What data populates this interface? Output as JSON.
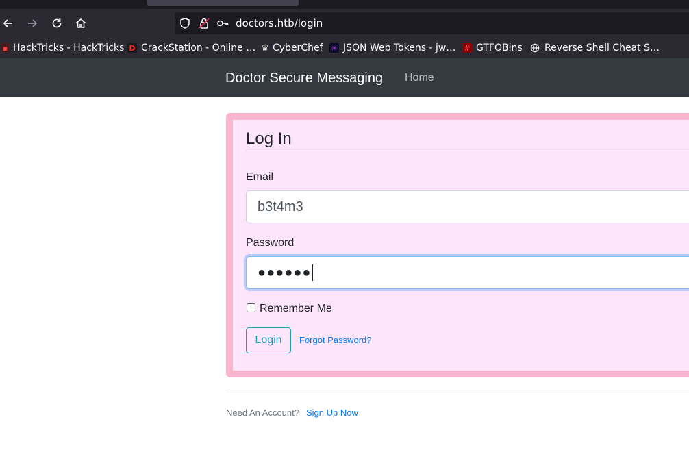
{
  "browser": {
    "url": "doctors.htb/login",
    "bookmarks": [
      {
        "label": "HackTricks - HackTricks",
        "icon": "hacktricks-icon"
      },
      {
        "label": "CrackStation - Online …",
        "icon": "crackstation-icon"
      },
      {
        "label": "CyberChef",
        "icon": "cyberchef-icon"
      },
      {
        "label": "JSON Web Tokens - jw…",
        "icon": "jwt-icon"
      },
      {
        "label": "GTFOBins",
        "icon": "gtfobins-icon"
      },
      {
        "label": "Reverse Shell Cheat S…",
        "icon": "globe-icon"
      }
    ]
  },
  "navbar": {
    "brand": "Doctor Secure Messaging",
    "home": "Home"
  },
  "form": {
    "legend": "Log In",
    "email_label": "Email",
    "email_value": "b3t4m3",
    "password_label": "Password",
    "password_value": "●●●●●●",
    "remember_label": "Remember Me",
    "submit_label": "Login",
    "forgot_label": "Forgot Password?"
  },
  "footer": {
    "need_account": "Need An Account?",
    "signup": "Sign Up Now"
  },
  "colors": {
    "navbar_bg": "#343a40",
    "card_bg": "#fde6fb",
    "card_border": "#fbb6cf",
    "link": "#007bff",
    "button_outline": "#17a2b8"
  }
}
